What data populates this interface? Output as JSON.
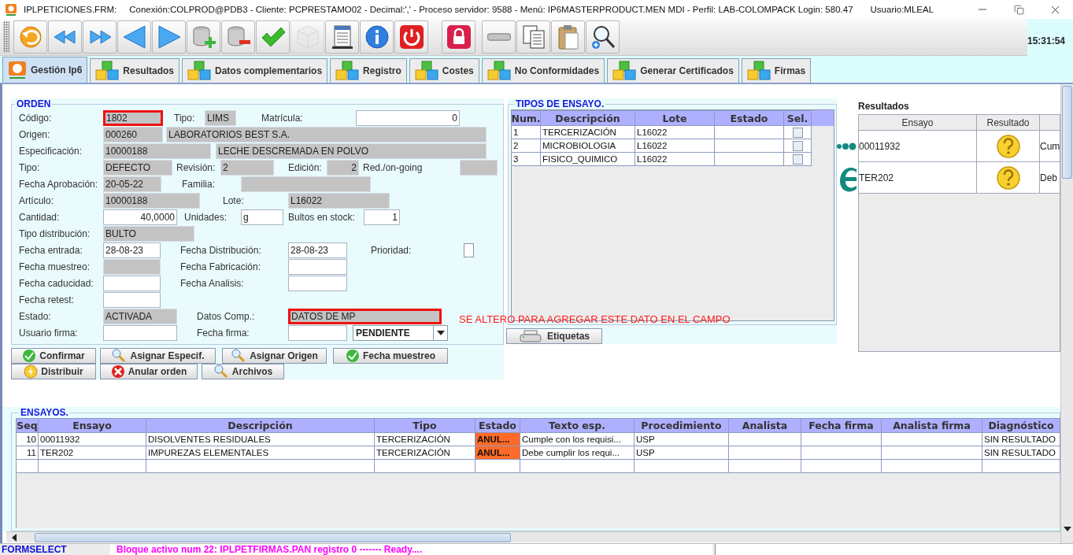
{
  "window": {
    "file": "IPLPETICIONES.FRM:",
    "connection": "Conexión:COLPROD@PDB3 - Cliente: PCPRESTAMO02 - Decimal:',' - Proceso servidor: 9588 - Menú: IP6MASTERPRODUCT.MEN MDI - Perfil: LAB-COLOMPACK Login: 580.47",
    "user": "Usuario:MLEAL"
  },
  "toolbar": [
    {
      "kind": "undo",
      "disabled": false
    },
    {
      "kind": "rewind",
      "disabled": false
    },
    {
      "kind": "forward",
      "disabled": false
    },
    {
      "kind": "previous",
      "disabled": false
    },
    {
      "kind": "next",
      "disabled": false
    },
    {
      "kind": "db-add",
      "disabled": false
    },
    {
      "kind": "db-remove",
      "disabled": false
    },
    {
      "kind": "check",
      "disabled": false
    },
    {
      "kind": "cube",
      "disabled": true
    },
    {
      "kind": "document",
      "disabled": false
    },
    {
      "kind": "info",
      "disabled": false
    },
    {
      "kind": "power",
      "disabled": false
    },
    {
      "kind": "lock",
      "disabled": false
    },
    {
      "kind": "bar",
      "disabled": false
    },
    {
      "kind": "copy",
      "disabled": false
    },
    {
      "kind": "paste",
      "disabled": false
    },
    {
      "kind": "zoom",
      "disabled": false
    }
  ],
  "clock": "15:31:54",
  "tabs": [
    {
      "label": "Gestión Ip6",
      "kind": "logo",
      "selected": true
    },
    {
      "label": "Resultados",
      "kind": "cubes",
      "selected": false
    },
    {
      "label": "Datos complementarios",
      "kind": "cubes",
      "selected": false
    },
    {
      "label": "Registro",
      "kind": "cubes",
      "selected": false
    },
    {
      "label": "Costes",
      "kind": "cubes",
      "selected": false
    },
    {
      "label": "No Conformidades",
      "kind": "cubes",
      "selected": false
    },
    {
      "label": "Generar Certificados",
      "kind": "cubes",
      "selected": false
    },
    {
      "label": "Firmas",
      "kind": "cubes",
      "selected": false
    }
  ],
  "orden": {
    "title": "ORDEN",
    "rows": [
      {
        "items": [
          {
            "kind": "label",
            "text": "Código:"
          },
          {
            "kind": "value",
            "text": "1802",
            "highlighted": true
          },
          {
            "kind": "label",
            "text": "Tipo:"
          },
          {
            "kind": "value",
            "text": "LIMS",
            "highlighted": false
          },
          {
            "kind": "label",
            "text": "Matrícula:"
          },
          {
            "kind": "input",
            "text": "0"
          }
        ]
      },
      {
        "items": [
          {
            "kind": "label",
            "text": "Origen:"
          },
          {
            "kind": "value",
            "text": "000260",
            "highlighted": false
          },
          {
            "kind": "value",
            "text": "LABORATORIOS BEST S.A.",
            "highlighted": false
          }
        ]
      },
      {
        "items": [
          {
            "kind": "label",
            "text": "Especificación:"
          },
          {
            "kind": "value",
            "text": "10000188",
            "highlighted": false
          },
          {
            "kind": "value",
            "text": "LECHE DESCREMADA EN POLVO",
            "highlighted": false
          }
        ]
      },
      {
        "items": [
          {
            "kind": "label",
            "text": "Tipo:"
          },
          {
            "kind": "value",
            "text": "DEFECTO",
            "highlighted": false
          },
          {
            "kind": "label",
            "text": "Revisión:"
          },
          {
            "kind": "value",
            "text": "2",
            "highlighted": false
          },
          {
            "kind": "label",
            "text": "Edición:"
          },
          {
            "kind": "value",
            "text": "2",
            "highlighted": false
          },
          {
            "kind": "label",
            "text": "Red./on-going"
          },
          {
            "kind": "value",
            "highlighted": false
          }
        ]
      },
      {
        "items": [
          {
            "kind": "label",
            "text": "Fecha Aprobación:"
          },
          {
            "kind": "value",
            "text": "20-05-22",
            "highlighted": false
          },
          {
            "kind": "label",
            "text": "Familia:"
          },
          {
            "kind": "value",
            "highlighted": false
          }
        ]
      },
      {
        "items": [
          {
            "kind": "label",
            "text": "Artículo:"
          },
          {
            "kind": "value",
            "text": "10000188",
            "highlighted": false
          },
          {
            "kind": "label",
            "text": "Lote:"
          },
          {
            "kind": "value",
            "text": "L16022",
            "highlighted": false
          }
        ]
      },
      {
        "items": [
          {
            "kind": "label",
            "text": "Cantidad:"
          },
          {
            "kind": "input",
            "text": "40,0000"
          },
          {
            "kind": "label",
            "text": "Unidades:"
          },
          {
            "kind": "input",
            "text": "g"
          },
          {
            "kind": "label",
            "text": "Bultos en stock:"
          },
          {
            "kind": "input",
            "text": "1"
          }
        ]
      },
      {
        "items": [
          {
            "kind": "label",
            "text": "Tipo distribución:"
          },
          {
            "kind": "value",
            "text": "BULTO",
            "highlighted": false
          }
        ]
      },
      {
        "items": [
          {
            "kind": "label",
            "text": "Fecha entrada:"
          },
          {
            "kind": "input",
            "text": "28-08-23"
          },
          {
            "kind": "label",
            "text": "Fecha Distribución:"
          },
          {
            "kind": "input",
            "text": "28-08-23"
          },
          {
            "kind": "label",
            "text": "Prioridad:"
          },
          {
            "kind": "checkbox",
            "checked": false
          }
        ]
      },
      {
        "items": [
          {
            "kind": "label",
            "text": "Fecha muestreo:"
          },
          {
            "kind": "value",
            "highlighted": false
          },
          {
            "kind": "label",
            "text": "Fecha Fabricación:"
          },
          {
            "kind": "input"
          }
        ]
      },
      {
        "items": [
          {
            "kind": "label",
            "text": "Fecha caducidad:"
          },
          {
            "kind": "input"
          },
          {
            "kind": "label",
            "text": "Fecha Analisis:"
          },
          {
            "kind": "input"
          }
        ]
      },
      {
        "items": [
          {
            "kind": "label",
            "text": "Fecha retest:"
          },
          {
            "kind": "input"
          }
        ]
      },
      {
        "items": [
          {
            "kind": "label",
            "text": "Estado:"
          },
          {
            "kind": "value",
            "text": "ACTIVADA",
            "highlighted": false
          },
          {
            "kind": "label",
            "text": "Datos Comp.:"
          },
          {
            "kind": "value",
            "text": "DATOS DE MP",
            "highlighted": true
          }
        ]
      },
      {
        "items": [
          {
            "kind": "label",
            "text": "Usuario firma:"
          },
          {
            "kind": "input"
          },
          {
            "kind": "label",
            "text": "Fecha firma:"
          },
          {
            "kind": "input"
          },
          {
            "kind": "select",
            "text": "PENDIENTE"
          }
        ]
      }
    ],
    "buttons": [
      [
        {
          "label": "Confirmar",
          "kind": "check"
        },
        {
          "label": "Asignar Especif.",
          "kind": "search"
        },
        {
          "label": "Asignar Origen",
          "kind": "search"
        },
        {
          "label": "Fecha muestreo",
          "kind": "check"
        }
      ],
      [
        {
          "label": "Distribuir",
          "kind": "bolt"
        },
        {
          "label": "Anular orden",
          "kind": "cancel"
        },
        {
          "label": "Archivos",
          "kind": "search"
        }
      ]
    ]
  },
  "annotation": "SE ALTERO PARA AGREGAR ESTE DATO EN EL CAMPO",
  "tipos": {
    "title": "TIPOS DE ENSAYO.",
    "columns": [
      "Num.",
      "Descripción",
      "Lote",
      "Estado",
      "Sel."
    ],
    "rows": [
      {
        "num": "1",
        "descripcion": "TERCERIZACIÓN",
        "lote": "L16022",
        "selected": false
      },
      {
        "num": "2",
        "descripcion": "MICROBIOLOGIA",
        "lote": "L16022",
        "selected": false
      },
      {
        "num": "3",
        "descripcion": "FISICO_QUIMICO",
        "lote": "L16022",
        "selected": false
      }
    ],
    "button": "Etiquetas"
  },
  "resultados": {
    "title": "Resultados",
    "columns": [
      "Ensayo",
      "Resultado"
    ],
    "rows": [
      {
        "ensayo": "00011932",
        "column_3": "Cum"
      },
      {
        "ensayo": "TER202",
        "column_3": "Deb"
      }
    ]
  },
  "ensayos": {
    "title": "ENSAYOS.",
    "columns": [
      "Seq",
      "Ensayo",
      "Descripción",
      "Tipo",
      "Estado",
      "Texto esp.",
      "Procedimiento",
      "Analista",
      "Fecha firma",
      "Analista firma",
      "Diagnóstico"
    ],
    "rows": [
      {
        "cells": [
          "10",
          "00011932",
          "DISOLVENTES RESIDUALES",
          "TERCERIZACIÓN",
          "ANUL...",
          "Cumple con los requisi...",
          "USP",
          "",
          "",
          "",
          "SIN RESULTADO"
        ],
        "color": "#ff6a28"
      },
      {
        "cells": [
          "11",
          "TER202",
          "IMPUREZAS ELEMENTALES",
          "TERCERIZACIÓN",
          "ANUL...",
          "Debe cumplir los requi...",
          "USP",
          "",
          "",
          "",
          "SIN RESULTADO"
        ],
        "color": "#ff6a28"
      }
    ]
  },
  "status_bar": {
    "form": "FORMSELECT",
    "message": "Bloque activo num 22: IPLPETFIRMAS.PAN  registro 0 ------- Ready...."
  }
}
